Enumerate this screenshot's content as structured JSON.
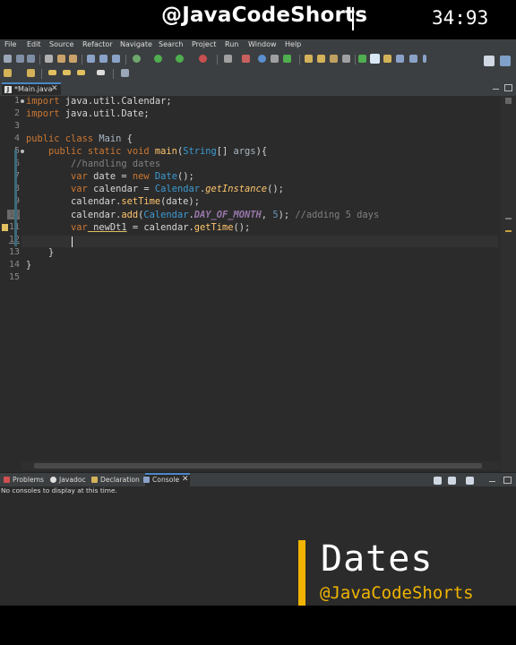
{
  "banner": {
    "handle": "@JavaCodeShorts",
    "timer": "34:93"
  },
  "menu": [
    "File",
    "Edit",
    "Source",
    "Refactor",
    "Navigate",
    "Search",
    "Project",
    "Run",
    "Window",
    "Help"
  ],
  "editor_tab": {
    "icon": "java-file-icon",
    "label": "*Main.java",
    "close": "✕"
  },
  "line_numbers": [
    "1",
    "2",
    "3",
    "4",
    "5",
    "6",
    "7",
    "8",
    "9",
    "10",
    "11",
    "12",
    "13",
    "14",
    "15"
  ],
  "code": {
    "l1_kw": "import",
    "l1_rest": " java.util.Calendar;",
    "l2_kw": "import",
    "l2_rest": " java.util.Date;",
    "l4_kw1": "public",
    "l4_kw2": " class",
    "l4_name": " Main",
    "l4_rest": " {",
    "l5_indent": "    ",
    "l5_kw1": "public",
    "l5_kw2": " static",
    "l5_kw3": " void",
    "l5_name": " main",
    "l5_p1": "(",
    "l5_type": "String",
    "l5_p2": "[] ",
    "l5_param": "args",
    "l5_p3": "){",
    "l6_indent": "        ",
    "l6_comment": "//handling dates",
    "l7_indent": "        ",
    "l7_kw": "var",
    "l7_var": " date",
    "l7_eq": " = ",
    "l7_new": "new",
    "l7_cls": " Date",
    "l7_end": "();",
    "l8_indent": "        ",
    "l8_kw": "var",
    "l8_var": " calendar",
    "l8_eq": " = ",
    "l8_cls": "Calendar",
    "l8_dot": ".",
    "l8_mth": "getInstance",
    "l8_end": "();",
    "l9_indent": "        ",
    "l9_obj": "calendar",
    "l9_dot": ".",
    "l9_mth": "setTime",
    "l9_end": "(date);",
    "l10_indent": "        ",
    "l10_obj": "calendar",
    "l10_dot": ".",
    "l10_mth": "add",
    "l10_p1": "(",
    "l10_cls": "Calendar",
    "l10_dot2": ".",
    "l10_fld": "DAY_OF_MONTH",
    "l10_comma": ", ",
    "l10_num": "5",
    "l10_end": "); ",
    "l10_comment": "//adding 5 days",
    "l11_indent": "        ",
    "l11_kw": "var",
    "l11_var": " newDt1",
    "l11_eq": " = ",
    "l11_obj": "calendar",
    "l11_dot": ".",
    "l11_mth": "getTime",
    "l11_end": "();",
    "l13_indent": "    ",
    "l13_brace": "}",
    "l14_brace": "}"
  },
  "bottom_tabs": {
    "problems": "Problems",
    "javadoc": "Javadoc",
    "declaration": "Declaration",
    "console": "Console",
    "console_close": "✕"
  },
  "console_message": "No consoles to display at this time.",
  "overlay": {
    "title": "Dates",
    "handle": "@JavaCodeShorts"
  },
  "colors": {
    "accent": "#f0b400",
    "editor_bg": "#2b2b2b",
    "chrome_bg": "#3c3f41"
  }
}
